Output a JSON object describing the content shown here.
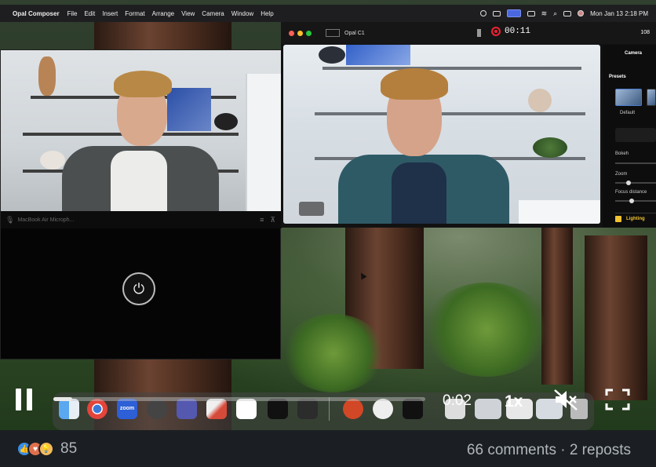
{
  "menubar": {
    "app_name": "Opal Composer",
    "menus": [
      "File",
      "Edit",
      "Insert",
      "Format",
      "Arrange",
      "View",
      "Camera",
      "Window",
      "Help"
    ],
    "clock": "Mon Jan 13  2:18 PM"
  },
  "left_window": {
    "mic_label": "MacBook Air Microph...",
    "power_icon": "power-icon"
  },
  "opal_window": {
    "device_name": "Opal C1",
    "recording_time": "00:11",
    "counter": "108",
    "panel": {
      "tab": "Camera",
      "presets_header": "Presets",
      "preset_default": "Default",
      "bokeh_label": "Bokeh",
      "zoom_label": "Zoom",
      "focus_label": "Focus distance",
      "lighting_label": "Lighting"
    }
  },
  "player": {
    "timestamp": "0:02",
    "speed": "1x",
    "progress": 0.05,
    "pause_icon": "pause-icon",
    "mute_icon": "speaker-muted-icon",
    "fullscreen_icon": "fullscreen-icon"
  },
  "social": {
    "reaction_count": "85",
    "comments_reposts": "66 comments · 2 reposts",
    "reaction_icons": [
      "like-icon",
      "love-icon",
      "insightful-icon"
    ],
    "colors": {
      "like": "#378fe9",
      "love": "#df704d",
      "insightful": "#f5bb5c"
    }
  },
  "dock": {
    "app_labels": [
      "zoom"
    ]
  }
}
